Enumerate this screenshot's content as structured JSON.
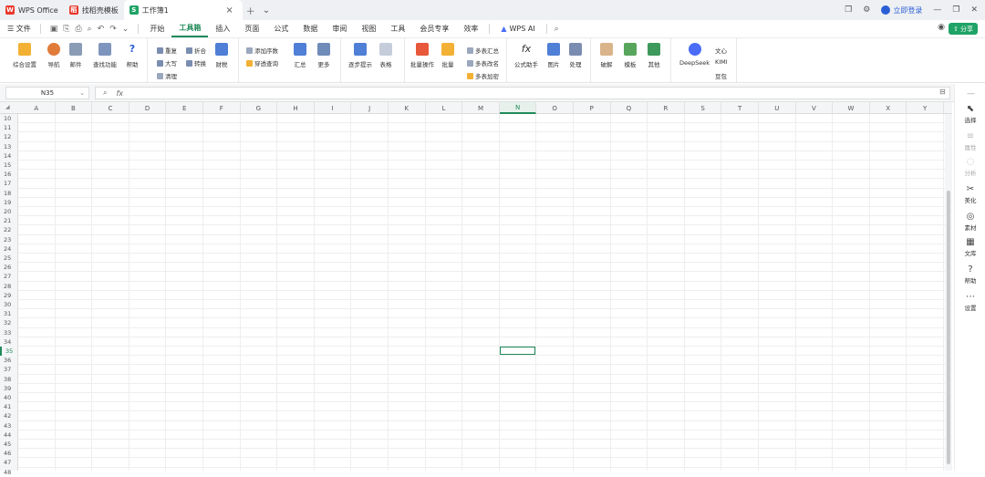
{
  "tabs": [
    {
      "label": "WPS Office",
      "badge": "W",
      "color": "#e8382c"
    },
    {
      "label": "找稻壳模板",
      "badge": "稻",
      "color": "#e8382c"
    },
    {
      "label": "工作簿1",
      "badge": "S",
      "color": "#1fa366"
    }
  ],
  "titlebar": {
    "login": "立即登录"
  },
  "menubar": {
    "file": "文件",
    "tabs": [
      "开始",
      "工具箱",
      "插入",
      "页面",
      "公式",
      "数据",
      "审阅",
      "视图",
      "工具",
      "会员专享",
      "效率"
    ],
    "active_tab": "工具箱",
    "ai": "WPS AI",
    "share": "分享"
  },
  "ribbon": {
    "big_buttons": [
      "综合设置",
      "导航",
      "邮件",
      "查找功能",
      "帮助",
      "汇总",
      "更多",
      "逐步提示",
      "表格",
      "批量操作",
      "批量",
      "公式助手",
      "图片",
      "处理",
      "破解",
      "模板",
      "其他",
      "DeepSeek"
    ],
    "small_buttons": [
      "重复",
      "折合",
      "大写",
      "转换",
      "清理",
      "财税",
      "添加序数",
      "穿透查询",
      "多表汇总",
      "多表改名",
      "多表加密",
      "文心",
      "KIMI",
      "豆包"
    ]
  },
  "formulabar": {
    "cell": "N35",
    "fx": "fx"
  },
  "grid": {
    "columns": [
      "A",
      "B",
      "C",
      "D",
      "E",
      "F",
      "G",
      "H",
      "I",
      "J",
      "K",
      "L",
      "M",
      "N",
      "O",
      "P",
      "Q",
      "R",
      "S",
      "T",
      "U",
      "V",
      "W",
      "X",
      "Y"
    ],
    "selected_col": "N",
    "rows": [
      10,
      11,
      12,
      13,
      14,
      15,
      16,
      17,
      18,
      19,
      20,
      21,
      22,
      23,
      24,
      25,
      26,
      27,
      28,
      29,
      30,
      31,
      32,
      33,
      34,
      35,
      36,
      37,
      38,
      39,
      40,
      41,
      42,
      43,
      44,
      45,
      46,
      47,
      48
    ],
    "selected_row": 35
  },
  "sidebar": [
    {
      "label": "选择",
      "icon": "cursor-icon",
      "dim": false
    },
    {
      "label": "属性",
      "icon": "properties-icon",
      "dim": true
    },
    {
      "label": "分析",
      "icon": "analysis-icon",
      "dim": true
    },
    {
      "label": "美化",
      "icon": "beautify-icon",
      "dim": false
    },
    {
      "label": "素材",
      "icon": "material-icon",
      "dim": false
    },
    {
      "label": "文库",
      "icon": "library-icon",
      "dim": false
    },
    {
      "label": "帮助",
      "icon": "help-icon",
      "dim": false
    },
    {
      "label": "设置",
      "icon": "settings-icon",
      "dim": false
    }
  ],
  "colors": {
    "accent": "#1f8a5a",
    "brand": "#e8382c",
    "share": "#1fa366"
  }
}
